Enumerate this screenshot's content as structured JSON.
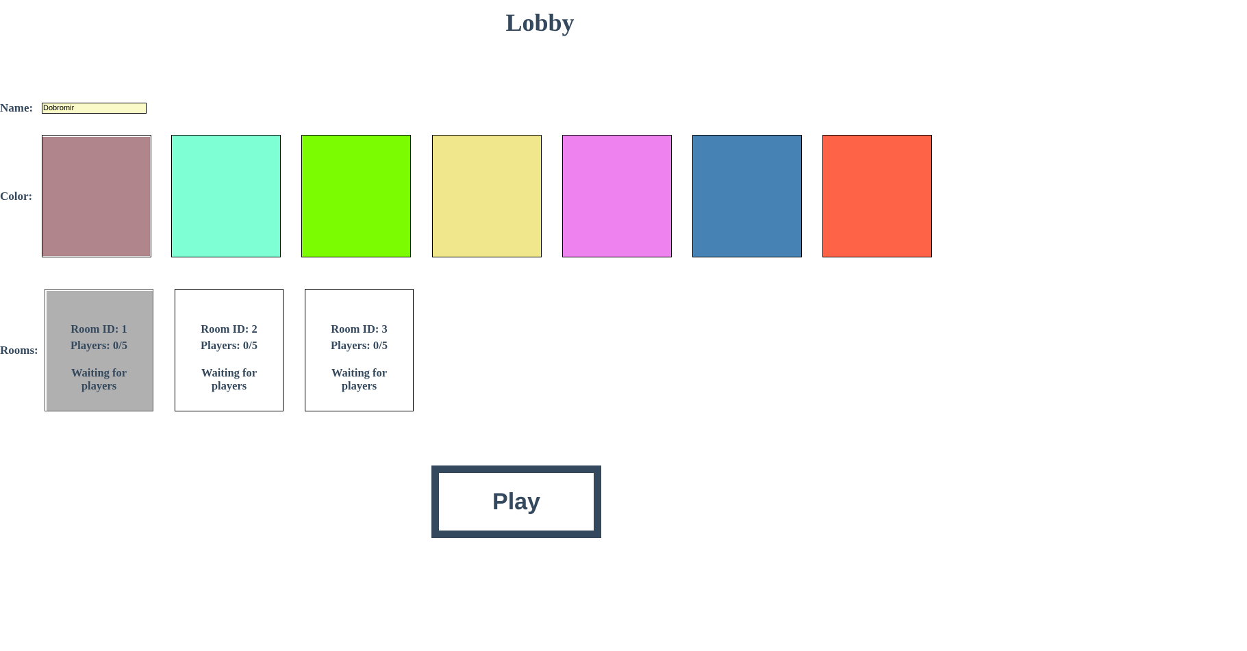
{
  "title": "Lobby",
  "labels": {
    "name": "Name:",
    "color": "Color:",
    "rooms": "Rooms:"
  },
  "name_input": {
    "value": "Dobromir"
  },
  "colors": [
    {
      "hex": "#b0868c",
      "selected": true
    },
    {
      "hex": "#7fffd4",
      "selected": false
    },
    {
      "hex": "#7cfc00",
      "selected": false
    },
    {
      "hex": "#f0e68c",
      "selected": false
    },
    {
      "hex": "#ee82ee",
      "selected": false
    },
    {
      "hex": "#4682b4",
      "selected": false
    },
    {
      "hex": "#ff6347",
      "selected": false
    }
  ],
  "rooms": [
    {
      "id": "Room ID: 1",
      "players": "Players: 0/5",
      "status": "Waiting for players",
      "selected": true
    },
    {
      "id": "Room ID: 2",
      "players": "Players: 0/5",
      "status": "Waiting for players",
      "selected": false
    },
    {
      "id": "Room ID: 3",
      "players": "Players: 0/5",
      "status": "Waiting for players",
      "selected": false
    }
  ],
  "play_button": {
    "label": "Play"
  },
  "theme": {
    "text_color": "#34495e",
    "input_bg": "#fafac8",
    "selected_room_bg": "#b0b0b0"
  }
}
